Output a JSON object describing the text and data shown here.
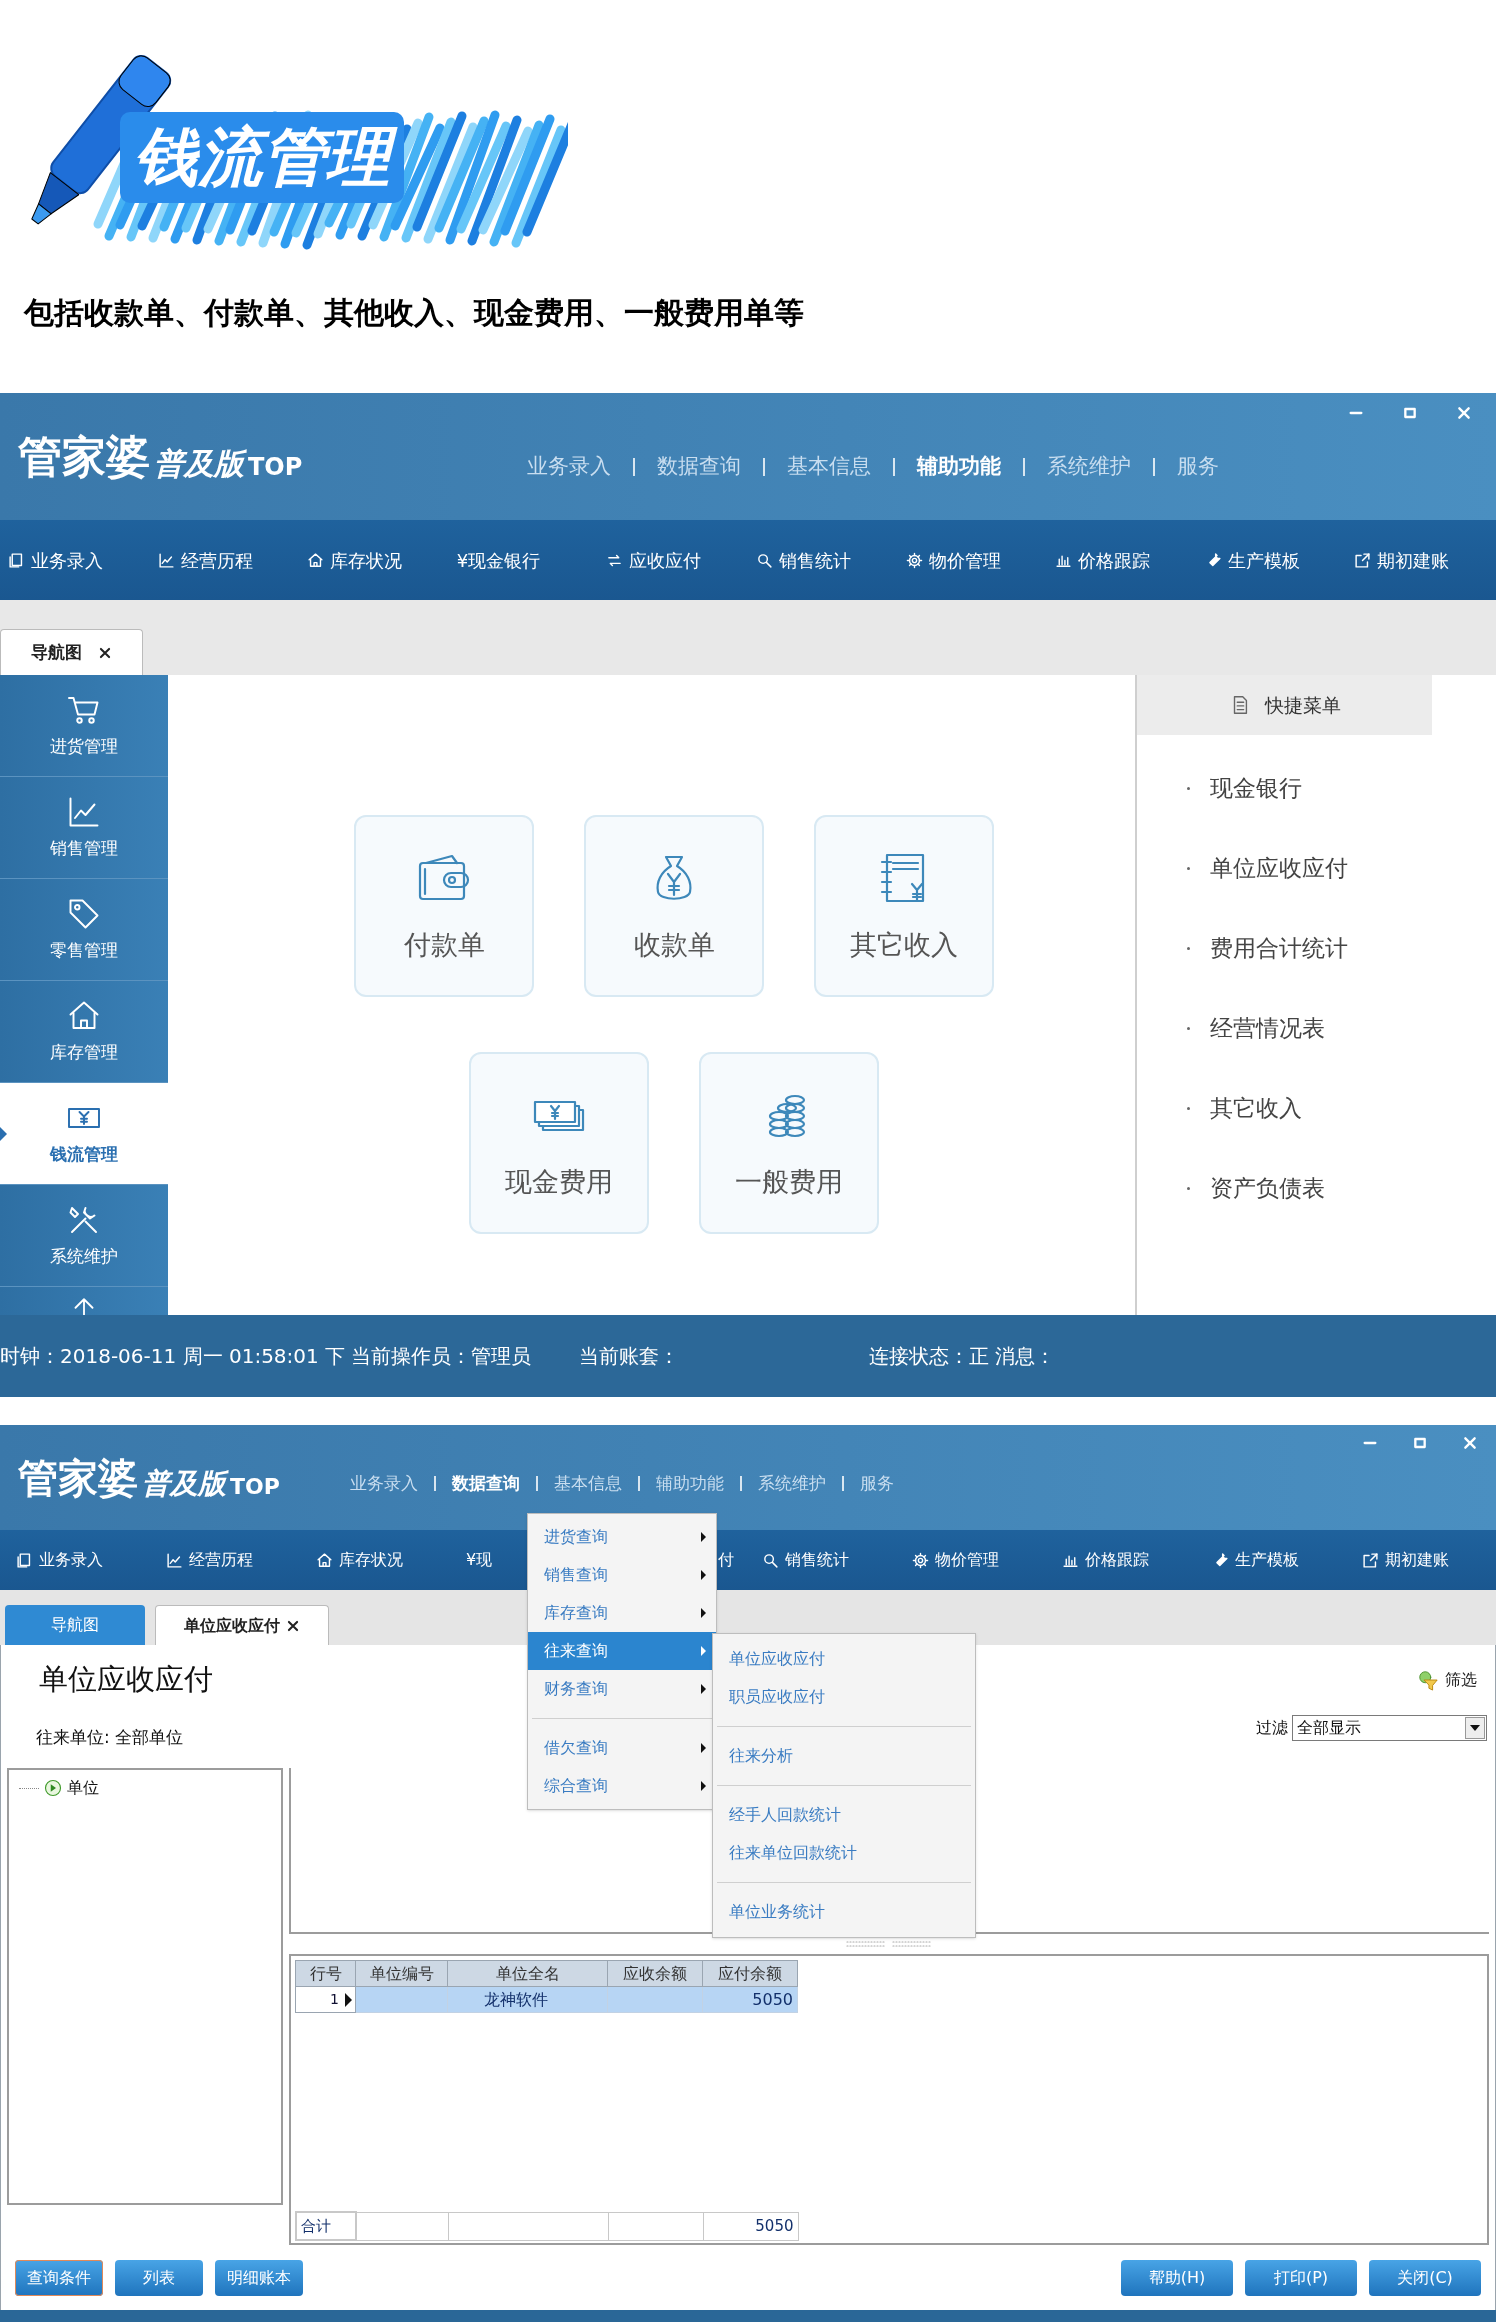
{
  "banner": {
    "title": "钱流管理",
    "subtitle": "包括收款单、付款单、其他收入、现金费用、一般费用单等"
  },
  "home_window": {
    "logo": {
      "name": "管家婆",
      "edition": "普及版",
      "tag": "TOP"
    },
    "top_menu": [
      {
        "label": "业务录入",
        "selected": false
      },
      {
        "label": "数据查询",
        "selected": false
      },
      {
        "label": "基本信息",
        "selected": false
      },
      {
        "label": "辅助功能",
        "selected": true
      },
      {
        "label": "系统维护",
        "selected": false
      },
      {
        "label": "服务",
        "selected": false
      }
    ],
    "toolbar": [
      {
        "label": "业务录入"
      },
      {
        "label": "经营历程"
      },
      {
        "label": "库存状况"
      },
      {
        "label": "¥现金银行"
      },
      {
        "label": "应收应付"
      },
      {
        "label": "销售统计"
      },
      {
        "label": "物价管理"
      },
      {
        "label": "价格跟踪"
      },
      {
        "label": "生产模板"
      },
      {
        "label": "期初建账"
      }
    ],
    "tabs": [
      {
        "label": "导航图",
        "selected": true,
        "closable": true
      }
    ],
    "sidebar": [
      {
        "label": "进货管理",
        "selected": false
      },
      {
        "label": "销售管理",
        "selected": false
      },
      {
        "label": "零售管理",
        "selected": false
      },
      {
        "label": "库存管理",
        "selected": false
      },
      {
        "label": "钱流管理",
        "selected": true
      },
      {
        "label": "系统维护",
        "selected": false
      }
    ],
    "tiles": [
      {
        "label": "付款单"
      },
      {
        "label": "收款单"
      },
      {
        "label": "其它收入"
      },
      {
        "label": "现金费用"
      },
      {
        "label": "一般费用"
      }
    ],
    "quick_menu": {
      "title": "快捷菜单",
      "items": [
        "现金银行",
        "单位应收应付",
        "费用合计统计",
        "经营情况表",
        "其它收入",
        "资产负债表"
      ]
    },
    "status_bar": {
      "clock": "时钟：2018-06-11 周一 01:58:01 下 当前操作员：管理员",
      "account": "当前账套：",
      "connection": "连接状态：正",
      "message": "消息："
    }
  },
  "report_window": {
    "logo": {
      "name": "管家婆",
      "edition": "普及版",
      "tag": "TOP"
    },
    "top_menu": [
      {
        "label": "业务录入",
        "selected": false
      },
      {
        "label": "数据查询",
        "selected": true
      },
      {
        "label": "基本信息",
        "selected": false
      },
      {
        "label": "辅助功能",
        "selected": false
      },
      {
        "label": "系统维护",
        "selected": false
      },
      {
        "label": "服务",
        "selected": false
      }
    ],
    "toolbar": [
      {
        "label": "业务录入",
        "kind": "button"
      },
      {
        "label": "经营历程",
        "kind": "button"
      },
      {
        "label": "库存状况",
        "kind": "button"
      },
      {
        "label": "¥现",
        "kind": "cutoff"
      },
      {
        "label": "付",
        "kind": "tail"
      },
      {
        "label": "销售统计",
        "kind": "button"
      },
      {
        "label": "物价管理",
        "kind": "button"
      },
      {
        "label": "价格跟踪",
        "kind": "button"
      },
      {
        "label": "生产模板",
        "kind": "button"
      },
      {
        "label": "期初建账",
        "kind": "button"
      }
    ],
    "tabs": [
      {
        "label": "导航图",
        "selected": false,
        "closable": false
      },
      {
        "label": "单位应收应付",
        "selected": true,
        "closable": true
      }
    ],
    "heading": "单位应收应付",
    "filter_button": "筛选",
    "partner": "往来单位: 全部单位",
    "filter": {
      "label": "过滤",
      "value": "全部显示"
    },
    "tree": [
      {
        "label": "单位"
      }
    ],
    "table": {
      "columns": [
        "行号",
        "单位编号",
        "单位全名",
        "应收余额",
        "应付余额"
      ],
      "rows": [
        {
          "number": "1",
          "name": "龙神软件",
          "payable": "5050",
          "selected": true
        }
      ],
      "total": {
        "label": "合计",
        "payable": "5050"
      }
    },
    "buttons_left": [
      {
        "label": "查询条件",
        "focused": true
      },
      {
        "label": "列表",
        "focused": false
      },
      {
        "label": "明细账本",
        "focused": false
      }
    ],
    "buttons_right": [
      {
        "label": "帮助(H)"
      },
      {
        "label": "打印(P)"
      },
      {
        "label": "关闭(C)"
      }
    ],
    "menu": [
      {
        "kind": "item",
        "label": "进货查询",
        "selected": false
      },
      {
        "kind": "item",
        "label": "销售查询",
        "selected": false
      },
      {
        "kind": "item",
        "label": "库存查询",
        "selected": false
      },
      {
        "kind": "item",
        "label": "往来查询",
        "selected": true
      },
      {
        "kind": "item",
        "label": "财务查询",
        "selected": false
      },
      {
        "kind": "separator"
      },
      {
        "kind": "item",
        "label": "借欠查询",
        "selected": false
      },
      {
        "kind": "item",
        "label": "综合查询",
        "selected": false
      }
    ],
    "submenu": [
      {
        "kind": "item",
        "label": "单位应收应付"
      },
      {
        "kind": "item",
        "label": "职员应收应付"
      },
      {
        "kind": "separator"
      },
      {
        "kind": "item",
        "label": "往来分析"
      },
      {
        "kind": "separator"
      },
      {
        "kind": "item",
        "label": "经手人回款统计"
      },
      {
        "kind": "item",
        "label": "往来单位回款统计"
      },
      {
        "kind": "separator"
      },
      {
        "kind": "item",
        "label": "单位业务统计"
      }
    ]
  }
}
